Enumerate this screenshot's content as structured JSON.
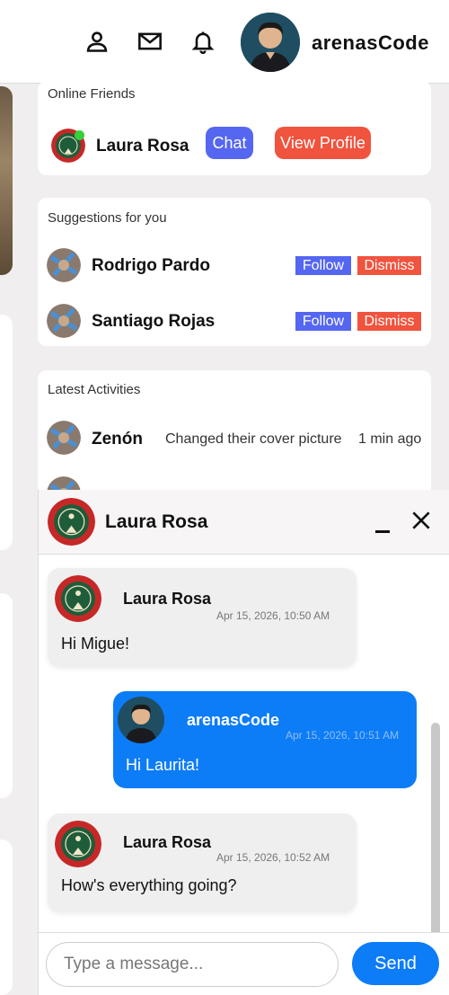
{
  "header": {
    "username": "arenasCode",
    "icons": [
      "user-icon",
      "mail-icon",
      "bell-icon"
    ]
  },
  "online_friends": {
    "title": "Online Friends",
    "friend": {
      "name": "Laura Rosa",
      "chat_label": "Chat",
      "profile_label": "View Profile"
    }
  },
  "suggestions": {
    "title": "Suggestions for you",
    "items": [
      {
        "name": "Rodrigo Pardo",
        "follow_label": "Follow",
        "dismiss_label": "Dismiss"
      },
      {
        "name": "Santiago Rojas",
        "follow_label": "Follow",
        "dismiss_label": "Dismiss"
      }
    ]
  },
  "activities": {
    "title": "Latest Activities",
    "items": [
      {
        "name": "Zenón",
        "action": "Changed their cover picture",
        "time": "1 min ago"
      }
    ]
  },
  "chat": {
    "contact_name": "Laura Rosa",
    "messages": [
      {
        "sender": "Laura Rosa",
        "time": "Apr 15, 2026, 10:50 AM",
        "text": "Hi Migue!"
      },
      {
        "sender": "arenasCode",
        "time": "Apr 15, 2026, 10:51 AM",
        "text": "Hi Laurita!"
      },
      {
        "sender": "Laura Rosa",
        "time": "Apr 15, 2026, 10:52 AM",
        "text": "How's everything going?"
      }
    ],
    "input_placeholder": "Type a message...",
    "send_label": "Send"
  },
  "colors": {
    "primary_blue": "#0d7cf7",
    "button_blue": "#5566f0",
    "button_red": "#f0533e",
    "online_green": "#35d03a"
  }
}
